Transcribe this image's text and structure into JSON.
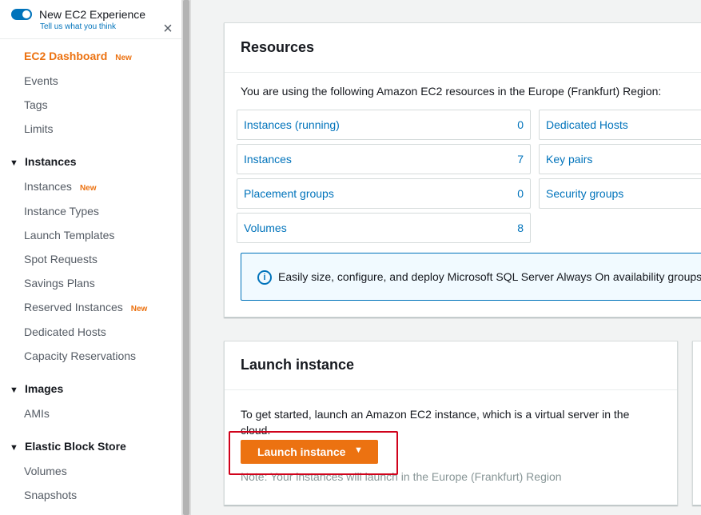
{
  "sidebar": {
    "toggle_title": "New EC2 Experience",
    "toggle_sub": "Tell us what you think",
    "close_glyph": "×",
    "dashboard": {
      "label": "EC2 Dashboard",
      "badge": "New"
    },
    "top_items": [
      "Events",
      "Tags",
      "Limits"
    ],
    "sections": [
      {
        "title": "Instances",
        "items": [
          {
            "label": "Instances",
            "badge": "New"
          },
          {
            "label": "Instance Types"
          },
          {
            "label": "Launch Templates"
          },
          {
            "label": "Spot Requests"
          },
          {
            "label": "Savings Plans"
          },
          {
            "label": "Reserved Instances",
            "badge": "New"
          },
          {
            "label": "Dedicated Hosts"
          },
          {
            "label": "Capacity Reservations"
          }
        ]
      },
      {
        "title": "Images",
        "items": [
          {
            "label": "AMIs"
          }
        ]
      },
      {
        "title": "Elastic Block Store",
        "items": [
          {
            "label": "Volumes"
          },
          {
            "label": "Snapshots"
          }
        ]
      }
    ]
  },
  "resources": {
    "title": "Resources",
    "intro": "You are using the following Amazon EC2 resources in the Europe (Frankfurt) Region:",
    "left": [
      {
        "label": "Instances (running)",
        "count": "0"
      },
      {
        "label": "Instances",
        "count": "7"
      },
      {
        "label": "Placement groups",
        "count": "0"
      },
      {
        "label": "Volumes",
        "count": "8"
      }
    ],
    "right": [
      {
        "label": "Dedicated Hosts"
      },
      {
        "label": "Key pairs"
      },
      {
        "label": "Security groups"
      }
    ],
    "info_text": "Easily size, configure, and deploy Microsoft SQL Server Always On availability groups"
  },
  "launch": {
    "title": "Launch instance",
    "body": "To get started, launch an Amazon EC2 instance, which is a virtual server in the cloud.",
    "button_label": "Launch instance",
    "button_caret": "▼",
    "note": "Note: Your instances will launch in the Europe (Frankfurt) Region"
  },
  "colors": {
    "accent": "#ec7211",
    "link": "#0073bb",
    "highlight": "#d0021b"
  }
}
